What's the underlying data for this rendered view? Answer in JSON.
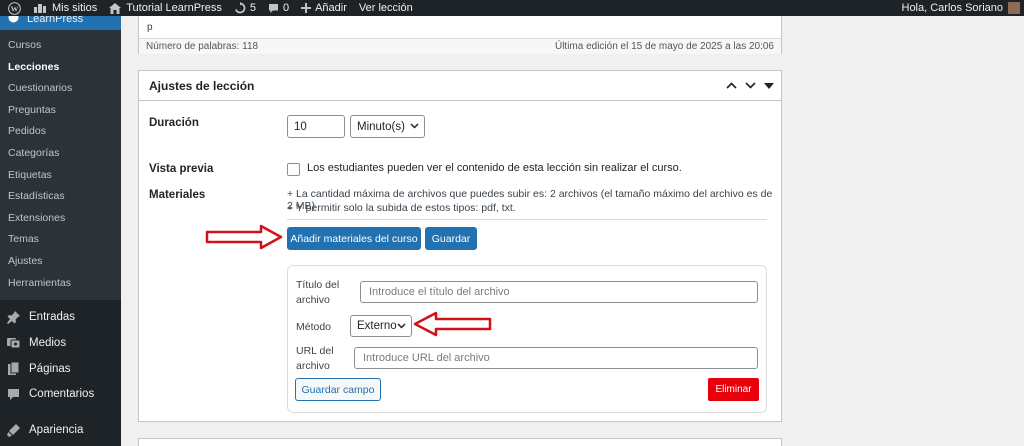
{
  "adminbar": {
    "my_sites": "Mis sitios",
    "site_name": "Tutorial LearnPress",
    "updates_count": "5",
    "comments_count": "0",
    "add_new": "Añadir",
    "view_lesson": "Ver lección",
    "greeting": "Hola, Carlos Soriano"
  },
  "sidebar": {
    "plugin_label": "LearnPress",
    "submenu": [
      "Cursos",
      "Lecciones",
      "Cuestionarios",
      "Preguntas",
      "Pedidos",
      "Categorías",
      "Etiquetas",
      "Estadísticas",
      "Extensiones",
      "Temas",
      "Ajustes",
      "Herramientas"
    ],
    "current_submenu": "Lecciones",
    "main": [
      {
        "label": "Entradas",
        "icon": "pin-icon"
      },
      {
        "label": "Medios",
        "icon": "media-icon"
      },
      {
        "label": "Páginas",
        "icon": "pages-icon"
      },
      {
        "label": "Comentarios",
        "icon": "comments-icon"
      },
      {
        "label": "Apariencia",
        "icon": "appearance-icon"
      }
    ]
  },
  "editor": {
    "content": "p",
    "word_count": "Número de palabras: 118",
    "last_edit": "Última edición el 15 de mayo de 2025 a las 20:06"
  },
  "metabox": {
    "title": "Ajustes de lección",
    "duration_label": "Duración",
    "duration_value": "10",
    "duration_unit": "Minuto(s)",
    "preview_label": "Vista previa",
    "preview_text": "Los estudiantes pueden ver el contenido de esta lección sin realizar el curso.",
    "preview_checked": false,
    "materials_label": "Materiales",
    "materials_info_1": "+ La cantidad máxima de archivos que puedes subir es: 2 archivos (el tamaño máximo del archivo es de 2 MB)",
    "materials_info_2": "+ Y permitir solo la subida de estos tipos: pdf, txt.",
    "add_materials_button": "Añadir materiales del curso",
    "save_button": "Guardar",
    "file_title_label_1": "Título del",
    "file_title_label_2": "archivo",
    "file_title_placeholder": "Introduce el título del archivo",
    "method_label": "Método",
    "method_value": "Externo",
    "url_label_1": "URL del",
    "url_label_2": "archivo",
    "url_placeholder": "Introduce URL del archivo",
    "save_field_button": "Guardar campo",
    "delete_button": "Eliminar"
  },
  "colors": {
    "admin_dark": "#1d2327",
    "accent": "#2271b1",
    "danger": "#e8000b",
    "annotation_arrow": "#d0121b"
  }
}
